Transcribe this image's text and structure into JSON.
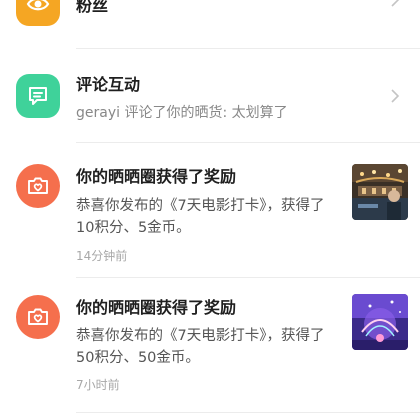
{
  "colors": {
    "fans_icon_bg": "#f5a623",
    "comment_icon_bg": "#3fd29a",
    "reward_icon_bg": "#f56f4d"
  },
  "rows": [
    {
      "icon": "eye-icon",
      "title": "粉丝"
    },
    {
      "icon": "chat-bubble-icon",
      "title": "评论互动",
      "subtitle": "gerayi 评论了你的晒货: 太划算了"
    },
    {
      "icon": "camera-heart-icon",
      "title": "你的晒晒圈获得了奖励",
      "body": "恭喜你发布的《7天电影打卡》，获得了10积分、5金币。",
      "time": "14分钟前"
    },
    {
      "icon": "camera-heart-icon",
      "title": "你的晒晒圈获得了奖励",
      "body": "恭喜你发布的《7天电影打卡》，获得了50积分、50金币。",
      "time": "7小时前"
    }
  ]
}
